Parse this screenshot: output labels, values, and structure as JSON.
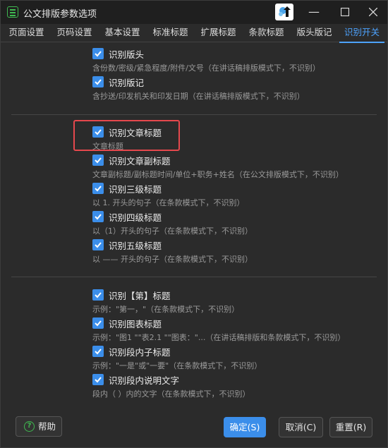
{
  "window": {
    "title": "公文排版参数选项"
  },
  "tabs": [
    {
      "label": "页面设置"
    },
    {
      "label": "页码设置"
    },
    {
      "label": "基本设置"
    },
    {
      "label": "标准标题"
    },
    {
      "label": "扩展标题"
    },
    {
      "label": "条款标题"
    },
    {
      "label": "版头版记"
    },
    {
      "label": "识别开关"
    }
  ],
  "active_tab": "识别开关",
  "groups": [
    {
      "options": [
        {
          "label": "识别版头",
          "desc": "含份数/密级/紧急程度/附件/文号（在讲话稿排版模式下，不识别）",
          "checked": true
        },
        {
          "label": "识别版记",
          "desc": "含抄送/印发机关和印发日期（在讲话稿排版模式下，不识别）",
          "checked": true
        }
      ]
    },
    {
      "options": [
        {
          "label": "识别文章标题",
          "desc": "文章标题",
          "checked": true
        },
        {
          "label": "识别文章副标题",
          "desc": "文章副标题/副标题时间/单位+职务+姓名（在公文排版模式下，不识别）",
          "checked": true
        },
        {
          "label": "识别三级标题",
          "desc": "以 1. 开头的句子（在条款模式下，不识别）",
          "checked": true
        },
        {
          "label": "识别四级标题",
          "desc": "以（1）开头的句子（在条款模式下，不识别）",
          "checked": true
        },
        {
          "label": "识别五级标题",
          "desc": "以 —— 开头的句子（在条款模式下，不识别）",
          "checked": true
        }
      ]
    },
    {
      "options": [
        {
          "label": "识别【第】标题",
          "desc": "示例：\"第一，\"（在条款模式下，不识别）",
          "checked": true
        },
        {
          "label": "识别图表标题",
          "desc": "示例：\"图1 \"\"表2.1 \"\"图表：\"...（在讲话稿排版和条款模式下，不识别）",
          "checked": true
        },
        {
          "label": "识别段内子标题",
          "desc": "示例：\"一是\"或\"一要\"（在条款模式下，不识别）",
          "checked": true
        },
        {
          "label": "识别段内说明文字",
          "desc": "段内（ ）内的文字（在条款模式下，不识别）",
          "checked": true
        }
      ]
    }
  ],
  "footer": {
    "help": "帮助",
    "ok": "确定(S)",
    "cancel": "取消(C)",
    "reset": "重置(R)"
  },
  "colors": {
    "accent": "#3b8eea",
    "tab_active": "#4da3ff",
    "highlight": "#e5484d",
    "help_icon": "#3fb950"
  }
}
